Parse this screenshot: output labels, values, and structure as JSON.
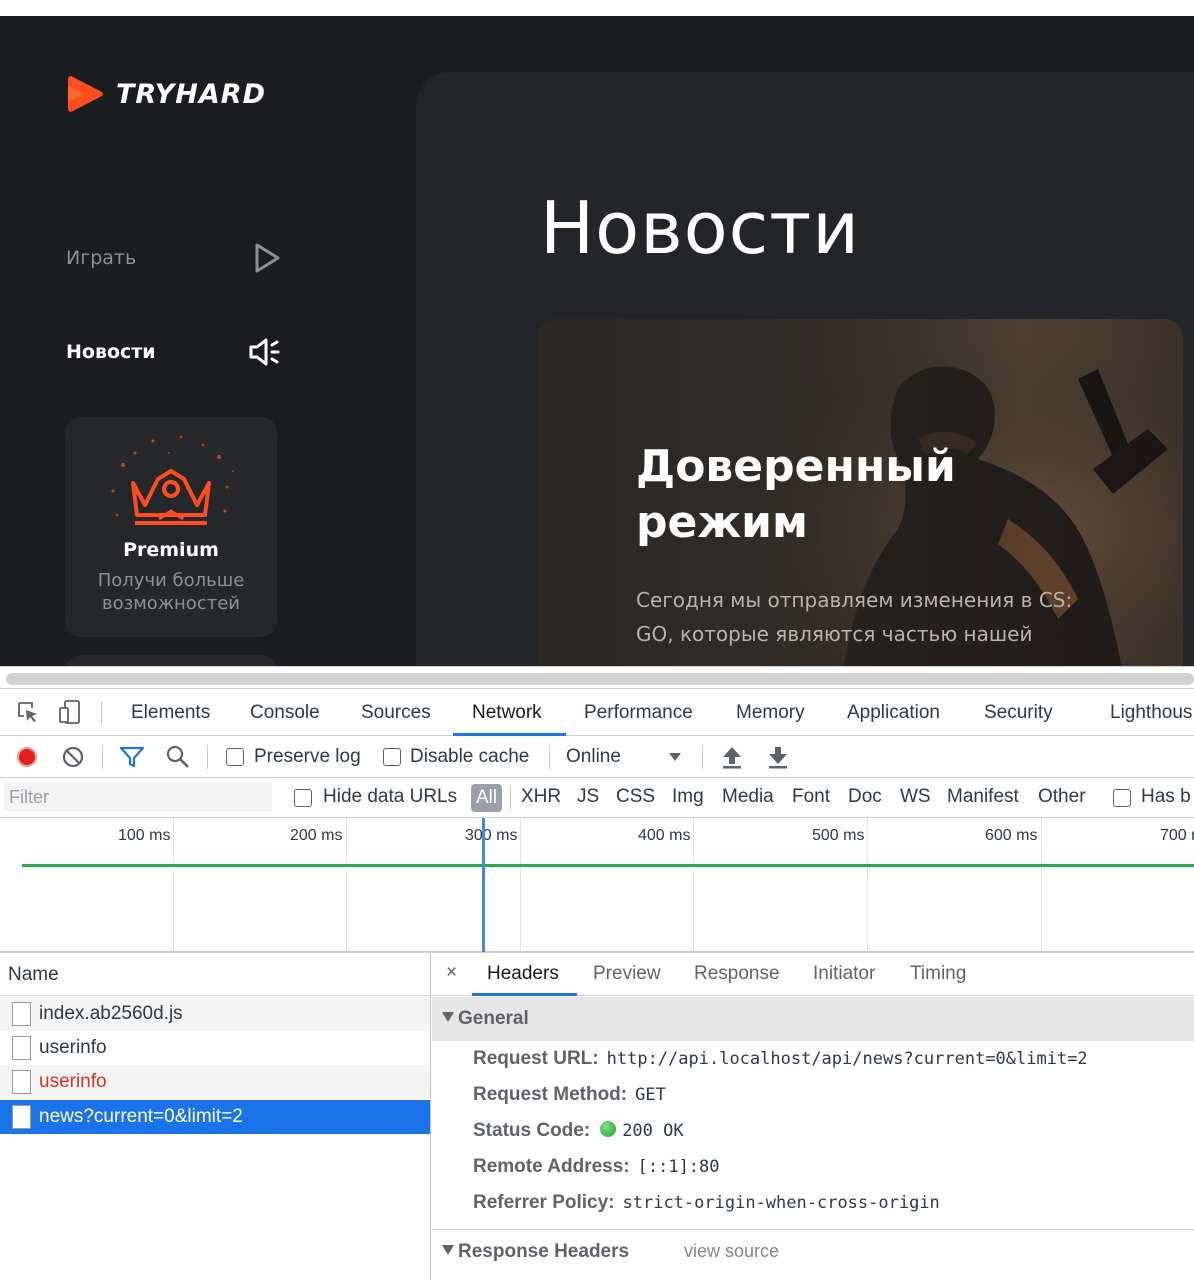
{
  "app": {
    "brand": "TRYHARD",
    "nav": [
      {
        "label": "Играть",
        "icon": "play-icon"
      },
      {
        "label": "Новости",
        "icon": "megaphone-icon"
      }
    ],
    "premium": {
      "title": "Premium",
      "subtitle": "Получи больше возможностей",
      "icon": "crown-icon"
    },
    "page_title": "Новости",
    "news_card": {
      "title": "Доверенный режим",
      "text": "Сегодня мы отправляем изменения в CS: GO, которые являются частью нашей"
    },
    "colors": {
      "accent": "#ff4d1f",
      "background": "#1c1d20",
      "panel": "#242529"
    }
  },
  "devtools": {
    "tabs": [
      "Elements",
      "Console",
      "Sources",
      "Network",
      "Performance",
      "Memory",
      "Application",
      "Security",
      "Lighthous"
    ],
    "active_tab": "Network",
    "toolbar": {
      "preserve_log": "Preserve log",
      "disable_cache": "Disable cache",
      "throttling": "Online"
    },
    "filter": {
      "placeholder": "Filter",
      "hide_data_urls": "Hide data URLs",
      "types": [
        "All",
        "XHR",
        "JS",
        "CSS",
        "Img",
        "Media",
        "Font",
        "Doc",
        "WS",
        "Manifest",
        "Other"
      ],
      "active_type": "All",
      "has_blocked": "Has b"
    },
    "timeline": {
      "ticks": [
        "100 ms",
        "200 ms",
        "300 ms",
        "400 ms",
        "500 ms",
        "600 ms",
        "700 r"
      ]
    },
    "requests": {
      "column": "Name",
      "rows": [
        {
          "name": "index.ab2560d.js",
          "status": "ok"
        },
        {
          "name": "userinfo",
          "status": "ok"
        },
        {
          "name": "userinfo",
          "status": "error"
        },
        {
          "name": "news?current=0&limit=2",
          "status": "selected"
        }
      ]
    },
    "details": {
      "close": "×",
      "tabs": [
        "Headers",
        "Preview",
        "Response",
        "Initiator",
        "Timing"
      ],
      "active_tab": "Headers",
      "general": {
        "label": "General",
        "rows": [
          {
            "key": "Request URL:",
            "value": "http://api.localhost/api/news?current=0&limit=2"
          },
          {
            "key": "Request Method:",
            "value": "GET"
          },
          {
            "key": "Status Code:",
            "value": "200 OK"
          },
          {
            "key": "Remote Address:",
            "value": "[::1]:80"
          },
          {
            "key": "Referrer Policy:",
            "value": "strict-origin-when-cross-origin"
          }
        ]
      },
      "response_headers": {
        "label": "Response Headers",
        "view_source": "view source"
      }
    }
  }
}
